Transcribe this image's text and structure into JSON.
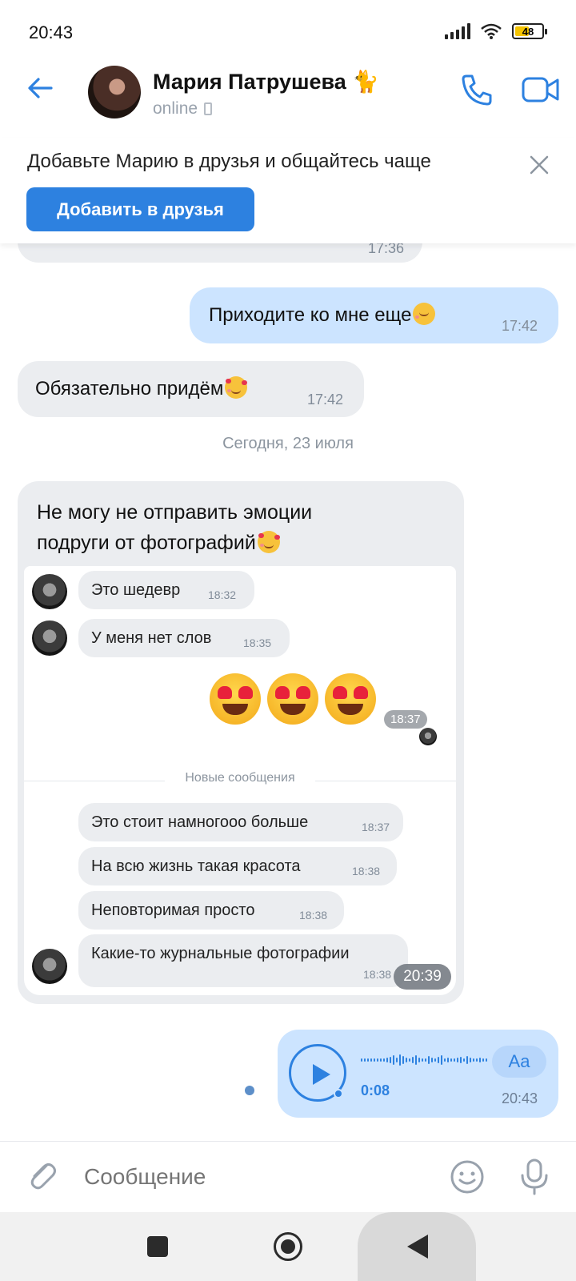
{
  "status_bar": {
    "time": "20:43",
    "battery": "48"
  },
  "header": {
    "name": "Мария Патрушева 🐈",
    "status": "online"
  },
  "banner": {
    "text": "Добавьте Марию в друзья и общайтесь чаще",
    "button": "Добавить в друзья"
  },
  "messages": {
    "partial_time": "17:36",
    "out1": {
      "text": "Приходите ко мне еще",
      "time": "17:42"
    },
    "in1": {
      "text": "Обязательно придём",
      "time": "17:42"
    },
    "date_separator": "Сегодня, 23 июля",
    "in2": {
      "line1": "Не могу не отправить эмоции",
      "line2": "подруги от фотографий",
      "time": "20:39"
    }
  },
  "screenshot": {
    "m1": {
      "text": "Это шедевр",
      "time": "18:32"
    },
    "m2": {
      "text": "У меня нет слов",
      "time": "18:35"
    },
    "emoji_time": "18:37",
    "new_messages": "Новые сообщения",
    "m3": {
      "text": "Это стоит намногооо больше",
      "time": "18:37"
    },
    "m4": {
      "text": "На всю жизнь такая красота",
      "time": "18:38"
    },
    "m5": {
      "text": "Неповторимая просто",
      "time": "18:38"
    },
    "m6": {
      "text": "Какие-то журнальные фотографии",
      "time": "18:38"
    }
  },
  "voice": {
    "duration": "0:08",
    "aa": "Aa",
    "time": "20:43"
  },
  "composer": {
    "placeholder": "Сообщение"
  },
  "colors": {
    "accent": "#2d81e0",
    "incoming": "#ebedf0",
    "outgoing": "#cce4ff"
  }
}
